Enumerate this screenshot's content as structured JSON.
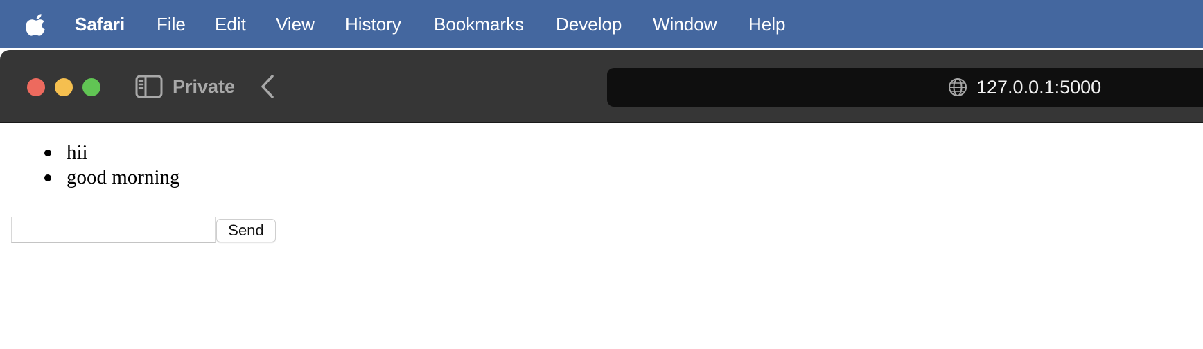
{
  "menubar": {
    "app_name": "Safari",
    "items": [
      "File",
      "Edit",
      "View",
      "History",
      "Bookmarks",
      "Develop",
      "Window",
      "Help"
    ],
    "background_color": "#44679f",
    "apple_icon": "apple-logo-icon"
  },
  "toolbar": {
    "private_label": "Private",
    "traffic_colors": {
      "close": "#ed6a5e",
      "minimize": "#f5bf4f",
      "zoom": "#61c554"
    },
    "sidebar_icon": "sidebar-icon",
    "back_icon": "chevron-left-icon"
  },
  "address_bar": {
    "url": "127.0.0.1:5000",
    "icon": "globe-icon"
  },
  "page": {
    "messages": [
      "hii",
      "good morning"
    ],
    "input_value": "",
    "send_label": "Send"
  }
}
